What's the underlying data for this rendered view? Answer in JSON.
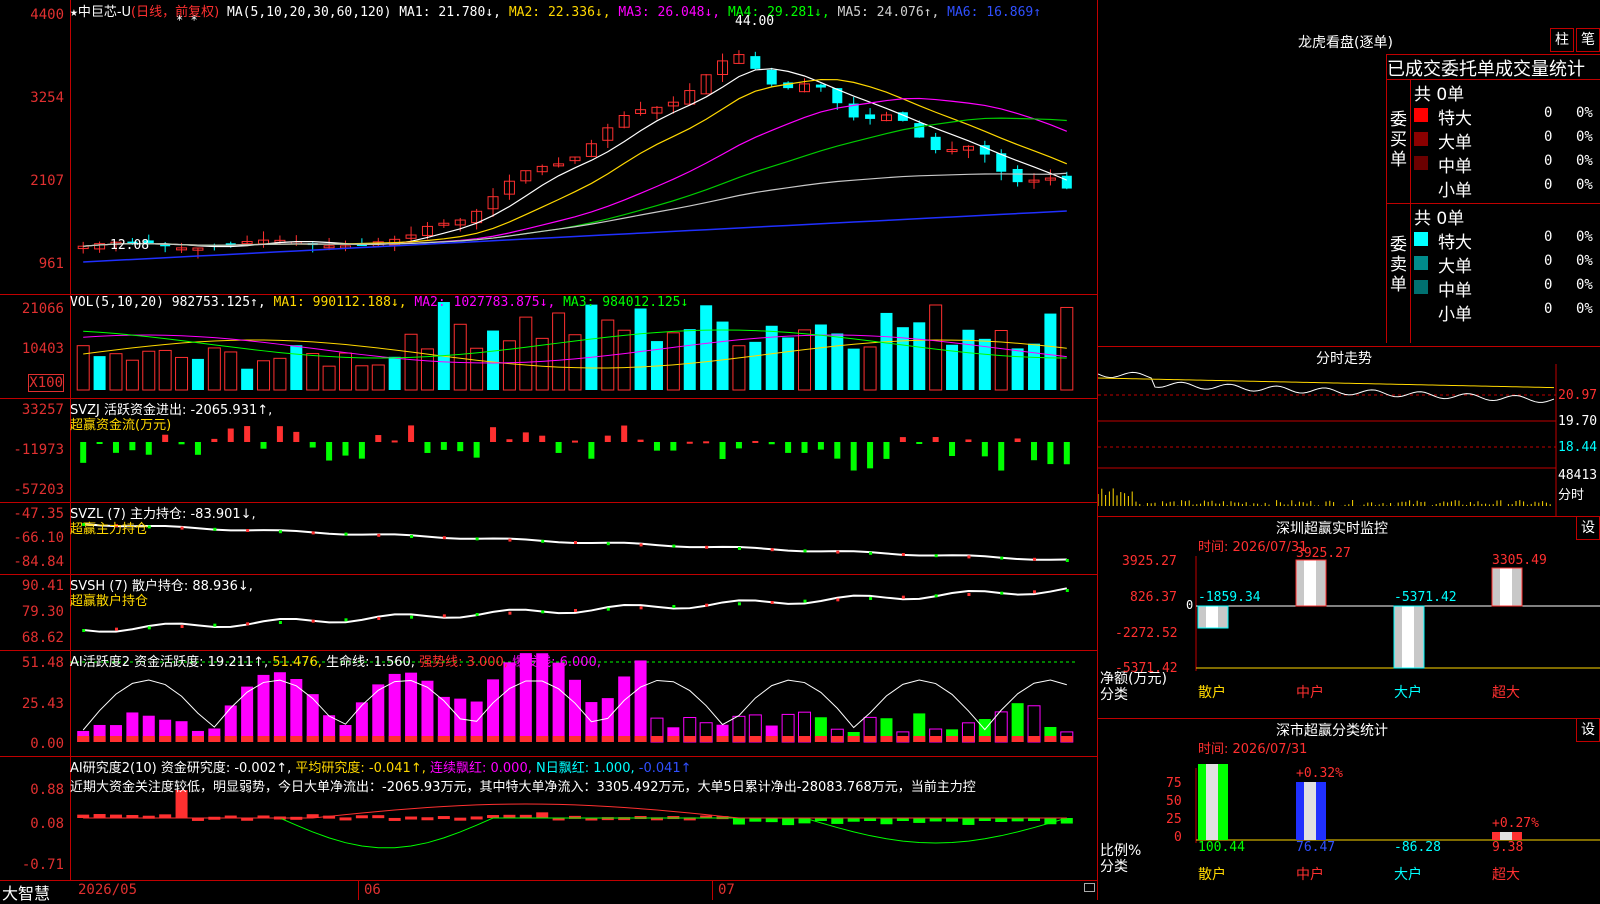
{
  "colors": {
    "up": "#ff3030",
    "down": "#00ffff",
    "grid": "#c00000",
    "magenta": "#ff00ff",
    "green": "#00ff00",
    "yellow": "#ffd800"
  },
  "price_panel": {
    "star": "★",
    "stock_name": "中巨芯-U",
    "period": "(日线，前复权)",
    "ma_group": "MA(5,10,20,30,60,120)",
    "ma1": "MA1: 21.780↓,",
    "ma2": "MA2: 22.336↓,",
    "ma3": "MA3: 26.048↓,",
    "ma4": "MA4: 29.281↓,",
    "ma5": "MA5: 24.076↑,",
    "ma6": "MA6: 16.869↑",
    "stars": "* *",
    "high_label": "44.00",
    "low_label": "12.08",
    "ticks": [
      "4400",
      "3254",
      "2107",
      "961"
    ]
  },
  "vol_panel": {
    "title": "VOL(5,10,20)",
    "value": "982753.125↑,",
    "ma1": "MA1: 990112.188↓,",
    "ma2": "MA2: 1027783.875↓,",
    "ma3": "MA3: 984012.125↓",
    "ticks": [
      "21066",
      "10403"
    ],
    "unit": "X100"
  },
  "svzj_panel": {
    "title": "SVZJ  活跃资金进出: -2065.931↑,",
    "subtitle": "超赢资金流(万元)",
    "ticks": [
      "33257",
      "-11973",
      "-57203"
    ]
  },
  "svzl_panel": {
    "title": "SVZL (7) 主力持仓: -83.901↓,",
    "subtitle": "超赢主力持仓",
    "ticks": [
      "-47.35",
      "-66.10",
      "-84.84"
    ]
  },
  "svsh_panel": {
    "title": "SVSH (7) 散户持仓: 88.936↓,",
    "subtitle": "超赢散户持仓",
    "ticks": [
      "90.41",
      "79.30",
      "68.62"
    ]
  },
  "ai1_panel": {
    "t1": "AI活跃度2 资金活跃度: 19.211↑,",
    "t2": "51.476,",
    "t3": "生命线: 1.560,",
    "t4": "强势线: 3.000,",
    "t5": "爆发线: 6.000,",
    "ticks": [
      "51.48",
      "25.43",
      "0.00"
    ]
  },
  "ai2_panel": {
    "t1": "AI研究度2(10) 资金研究度: -0.002↑,",
    "t2": "平均研究度: -0.041↑,",
    "t3": "连续飘红: 0.000,",
    "t4": "N日飘红: 1.000,",
    "t5": "-0.041↑",
    "comment": "近期大资金关注度较低，明显弱势，今日大单净流出：-2065.93万元，其中特大单净流入：3305.492万元，大单5日累计净出-28083.768万元，当前主力控",
    "ticks": [
      "0.88",
      "0.08",
      "-0.71"
    ]
  },
  "date_axis": {
    "brand": "大智慧",
    "d1": "2026/05",
    "d2": "06",
    "d3": "07"
  },
  "lhb": {
    "title": "龙虎看盘(逐单)",
    "btn1": "柱",
    "btn2": "笔",
    "tabs": "已成交委托单成交量统计",
    "buy_side": "委买单",
    "sell_side": "委卖单",
    "buy_total": "共 0单",
    "sell_total": "共 0单",
    "buy_rows": [
      {
        "label": "特大",
        "n": "0",
        "p": "0%"
      },
      {
        "label": "大单",
        "n": "0",
        "p": "0%"
      },
      {
        "label": "中单",
        "n": "0",
        "p": "0%"
      },
      {
        "label": "小单",
        "n": "0",
        "p": "0%"
      }
    ],
    "sell_rows": [
      {
        "label": "特大",
        "n": "0",
        "p": "0%"
      },
      {
        "label": "大单",
        "n": "0",
        "p": "0%"
      },
      {
        "label": "中单",
        "n": "0",
        "p": "0%"
      },
      {
        "label": "小单",
        "n": "0",
        "p": "0%"
      }
    ]
  },
  "fenshi": {
    "title": "分时走势",
    "p1": "20.97",
    "p2": "19.70",
    "p3": "18.44",
    "v": "48413",
    "unit": "分时"
  },
  "monitor": {
    "title": "深圳超赢实时监控",
    "settings": "设",
    "time": "时间: 2026/07/31",
    "ticks": [
      "3925.27",
      "826.37",
      "-2272.52",
      "-5371.42"
    ],
    "ylabel": "净额(万元)",
    "xlabel": "分类",
    "categories": [
      "散户",
      "中户",
      "大户",
      "超大"
    ],
    "values": [
      "-1859.34",
      "3925.27",
      "-5371.42",
      "3305.49"
    ],
    "zero": "0"
  },
  "classify": {
    "title": "深市超赢分类统计",
    "settings": "设",
    "time": "时间: 2026/07/31",
    "ticks": [
      "75",
      "50",
      "25",
      "0"
    ],
    "ylabel": "比例%",
    "xlabel": "分类",
    "categories": [
      "散户",
      "中户",
      "大户",
      "超大"
    ],
    "values": [
      "100.44",
      "76.47",
      "-86.28",
      "9.38"
    ],
    "pct1": "+0.32%",
    "pct2": "+0.27%"
  }
}
